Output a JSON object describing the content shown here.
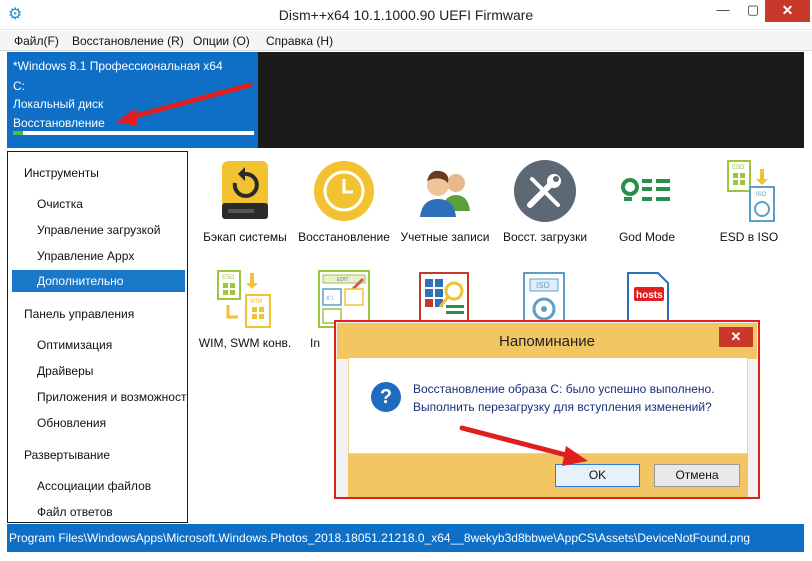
{
  "window": {
    "title": "Dism++x64 10.1.1000.90 UEFI Firmware",
    "app_icon": "gears-icon",
    "min_label": "—",
    "max_label": "▢",
    "close_label": "✕"
  },
  "menu": {
    "items": [
      {
        "label": "Файл(F)"
      },
      {
        "label": "Восстановление (R)"
      },
      {
        "label": "Опции (O)"
      },
      {
        "label": "Справка (H)"
      }
    ]
  },
  "system": {
    "name": "*Windows 8.1 Профессиональная x64",
    "drive": "C:",
    "disk_type": "Локальный диск",
    "status": "Восстановление",
    "progress": 0.04
  },
  "sidebar": {
    "categories": [
      {
        "label": "Инструменты",
        "items": [
          "Очистка",
          "Управление загрузкой",
          "Управление Appx",
          "Дополнительно"
        ]
      },
      {
        "label": "Панель управления",
        "items": [
          "Оптимизация",
          "Драйверы",
          "Приложения и возможности",
          "Обновления"
        ]
      },
      {
        "label": "Развертывание",
        "items": [
          "Ассоциации файлов",
          "Файл ответов"
        ]
      }
    ],
    "active_item": "Дополнительно"
  },
  "tools": [
    {
      "label": "Бэкап системы",
      "icon": "drive-backup-icon"
    },
    {
      "label": "Восстановление",
      "icon": "clock-restore-icon"
    },
    {
      "label": "Учетные записи",
      "icon": "users-icon"
    },
    {
      "label": "Восст. загрузки",
      "icon": "wrench-screwdriver-icon"
    },
    {
      "label": "God Mode",
      "icon": "god-mode-icon"
    },
    {
      "label": "ESD в ISO",
      "icon": "esd-to-iso-icon"
    },
    {
      "label": "WIM, SWM конв.",
      "icon": "wim-swm-convert-icon"
    },
    {
      "label": "In",
      "icon": "image-edit-icon"
    },
    {
      "label": "",
      "icon": "search-image-icon"
    },
    {
      "label": "",
      "icon": "iso-icon"
    },
    {
      "label": "",
      "icon": "hosts-icon",
      "text": "hosts"
    }
  ],
  "status_bar": {
    "path": "Program Files\\WindowsApps\\Microsoft.Windows.Photos_2018.18051.21218.0_x64__8wekyb3d8bbwe\\AppCS\\Assets\\DeviceNotFound.png"
  },
  "dialog": {
    "title": "Напоминание",
    "close_label": "✕",
    "message_line1": "Восстановление образа С: было успешно выполнено.",
    "message_line2": "Выполнить перезагрузку для вступления изменений?",
    "ok_label": "OK",
    "cancel_label": "Отмена",
    "icon": "question-icon",
    "question_mark": "?"
  },
  "colors": {
    "accent_blue": "#0f6fc6",
    "sidebar_active": "#1a78c8",
    "dialog_header": "#f3c664",
    "highlight_red": "#e0201c",
    "close_red": "#c8382b"
  }
}
